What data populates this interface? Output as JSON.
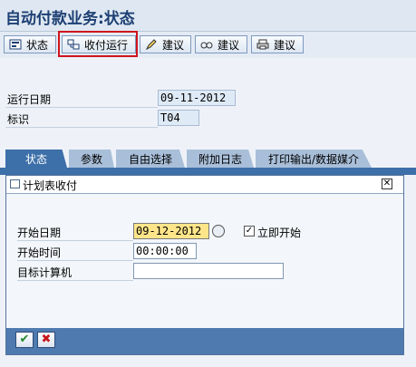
{
  "window": {
    "title": "自动付款业务:状态"
  },
  "toolbar": {
    "buttons": [
      {
        "label": "状态",
        "icon": "status-icon"
      },
      {
        "label": "收付运行",
        "icon": "payment-run-icon"
      },
      {
        "label": "建议",
        "icon": "pencil-icon"
      },
      {
        "label": "建议",
        "icon": "glasses-icon"
      },
      {
        "label": "建议",
        "icon": "printer-icon"
      }
    ]
  },
  "header": {
    "run_date_label": "运行日期",
    "run_date_value": "09-11-2012",
    "id_label": "标识",
    "id_value": "T04"
  },
  "tabs": [
    {
      "label": "状态",
      "active": true
    },
    {
      "label": "参数",
      "active": false
    },
    {
      "label": "自由选择",
      "active": false
    },
    {
      "label": "附加日志",
      "active": false
    },
    {
      "label": "打印输出/数据媒介",
      "active": false
    }
  ],
  "dialog": {
    "title": "计划表收付",
    "fields": {
      "start_date_label": "开始日期",
      "start_date_value": "09-12-2012",
      "start_immediately_label": "立即开始",
      "start_immediately_checked": true,
      "start_time_label": "开始时间",
      "start_time_value": "00:00:00",
      "target_computer_label": "目标计算机",
      "target_computer_value": ""
    },
    "footer": {
      "confirm_icon": "checkmark-icon",
      "cancel_icon": "cancel-icon"
    }
  },
  "colors": {
    "accent": "#3d6fa9",
    "highlight_box": "#d0141e",
    "focused_field": "#ffe58a"
  }
}
